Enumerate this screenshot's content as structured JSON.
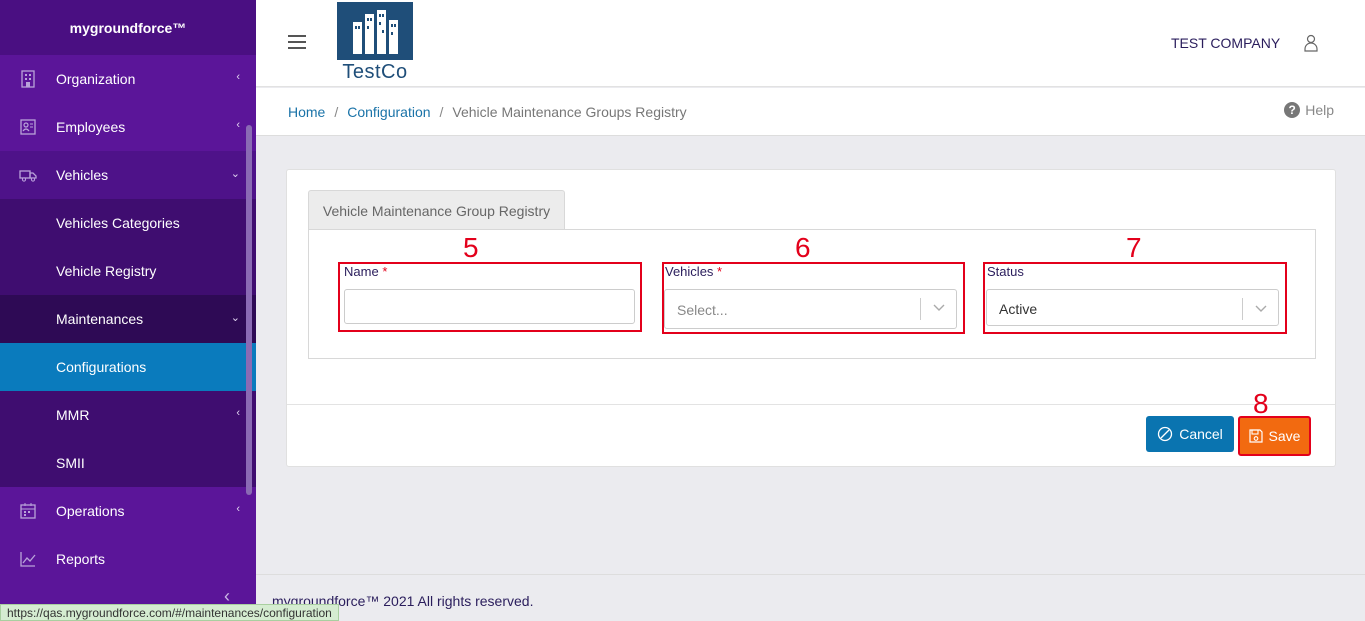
{
  "sidebar": {
    "brand": "mygroundforce™",
    "items": [
      {
        "label": "Organization",
        "icon": "building-icon"
      },
      {
        "label": "Employees",
        "icon": "id-card-icon"
      },
      {
        "label": "Vehicles",
        "icon": "truck-icon"
      },
      {
        "label": "Vehicles Categories"
      },
      {
        "label": "Vehicle Registry"
      },
      {
        "label": "Maintenances"
      },
      {
        "label": "Configurations"
      },
      {
        "label": "MMR"
      },
      {
        "label": "SMII"
      },
      {
        "label": "Operations",
        "icon": "calendar-icon"
      },
      {
        "label": "Reports",
        "icon": "chart-line-icon"
      }
    ]
  },
  "header": {
    "logo_text": "TestCo",
    "company": "TEST COMPANY"
  },
  "breadcrumb": {
    "home": "Home",
    "configuration": "Configuration",
    "current": "Vehicle Maintenance Groups Registry",
    "help": "Help"
  },
  "form": {
    "tab_label": "Vehicle Maintenance Group Registry",
    "name_label": "Name",
    "name_value": "",
    "vehicles_label": "Vehicles",
    "vehicles_placeholder": "Select...",
    "status_label": "Status",
    "status_value": "Active",
    "required_mark": "*",
    "cancel_label": "Cancel",
    "save_label": "Save"
  },
  "annotations": {
    "n5": "5",
    "n6": "6",
    "n7": "7",
    "n8": "8"
  },
  "footer": {
    "copyright": "mygroundforce™ 2021 All rights reserved.",
    "status_url": "https://qas.mygroundforce.com/#/maintenances/configuration"
  },
  "colors": {
    "sidebar": "#5b1599",
    "active": "#0a7bbd",
    "cancel": "#0a74b0",
    "save": "#f26a10",
    "annotation": "#e3001b"
  }
}
